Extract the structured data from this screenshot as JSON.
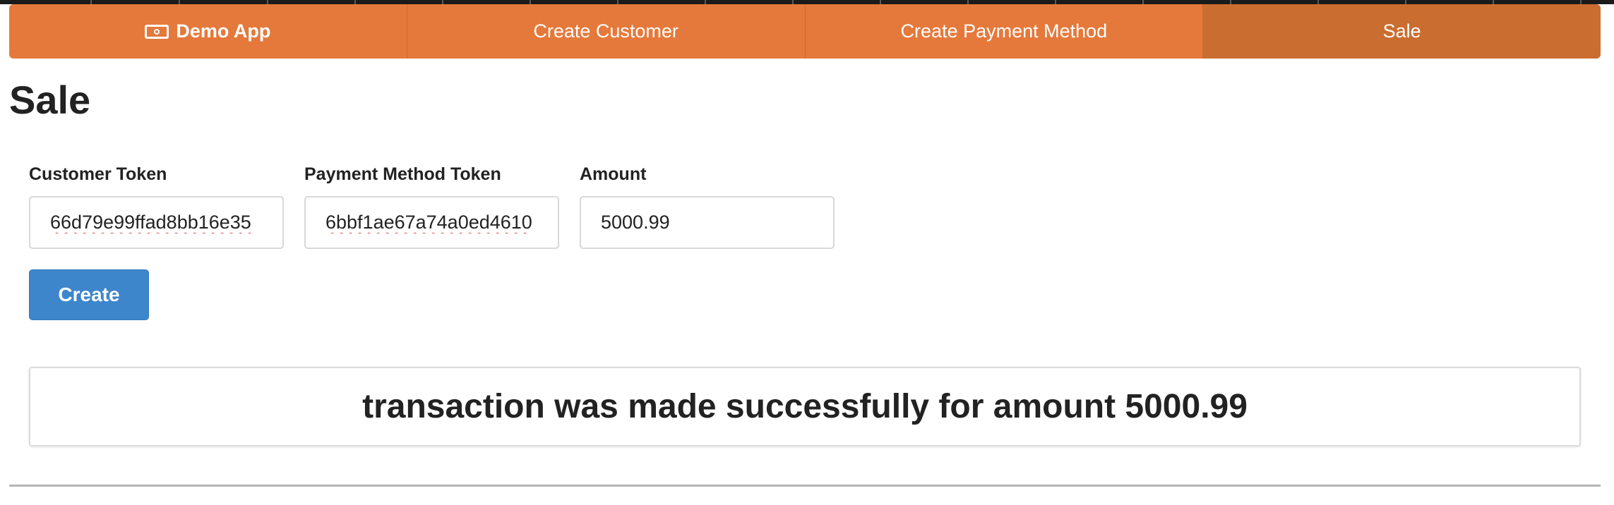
{
  "nav": {
    "brand_label": "Demo App",
    "brand_icon": "money-bill-icon",
    "items": [
      {
        "label": "Create Customer"
      },
      {
        "label": "Create Payment Method"
      },
      {
        "label": "Sale",
        "active": true
      }
    ],
    "accent_color": "#e5793b",
    "active_color": "#ca6d31"
  },
  "page": {
    "title": "Sale"
  },
  "form": {
    "customer_token": {
      "label": "Customer Token",
      "value": "66d79e99ffad8bb16e35"
    },
    "payment_method_token": {
      "label": "Payment Method Token",
      "value": "6bbf1ae67a74a0ed4610"
    },
    "amount": {
      "label": "Amount",
      "value": "5000.99"
    },
    "submit_label": "Create",
    "submit_color": "#3d86cc"
  },
  "result": {
    "message": "transaction was made successfully for amount 5000.99"
  }
}
